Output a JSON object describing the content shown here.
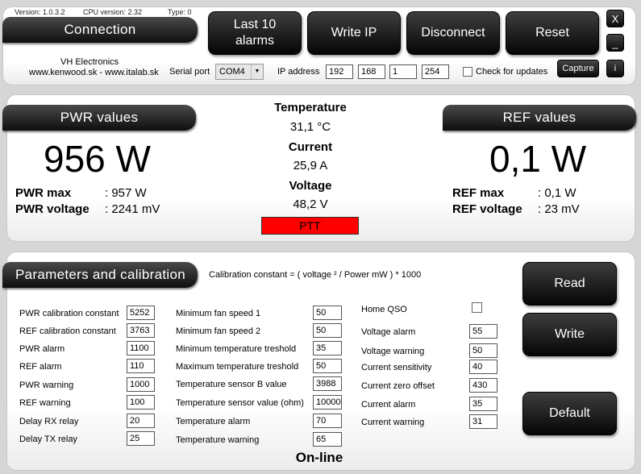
{
  "header": {
    "version": "Version: 1.0.3.2",
    "cpu_version": "CPU version: 2.32",
    "type": "Type: 0",
    "connection_tab": "Connection",
    "company": "VH  Electronics",
    "website": "www.kenwood.sk - www.italab.sk",
    "serial_port_label": "Serial port",
    "serial_port_value": "COM4",
    "ip_label": "IP address",
    "ip": [
      "192",
      "168",
      "1",
      "254"
    ],
    "check_updates": "Check for updates",
    "buttons": {
      "last_alarms": "Last 10\nalarms",
      "write_ip": "Write IP",
      "disconnect": "Disconnect",
      "reset": "Reset",
      "close": "X",
      "minimize": "_",
      "capture": "Capture",
      "info": "i"
    }
  },
  "measure": {
    "pwr_tab": "PWR values",
    "ref_tab": "REF values",
    "pwr_value": "956 W",
    "ref_value": "0,1 W",
    "pwr_max_label": "PWR max",
    "pwr_max_value": ": 957 W",
    "pwr_voltage_label": "PWR voltage",
    "pwr_voltage_value": ": 2241 mV",
    "ref_max_label": "REF max",
    "ref_max_value": ": 0,1 W",
    "ref_voltage_label": "REF voltage",
    "ref_voltage_value": ": 23 mV",
    "temperature_label": "Temperature",
    "temperature_value": "31,1 °C",
    "current_label": "Current",
    "current_value": "25,9 A",
    "voltage_label": "Voltage",
    "voltage_value": "48,2 V",
    "ptt": "PTT",
    "ptt_color": "#ff0000"
  },
  "params": {
    "tab": "Parameters and calibration",
    "formula": "Calibration constant = ( voltage ² / Power mW ) * 1000",
    "col1": [
      {
        "label": "PWR calibration constant",
        "value": "5252"
      },
      {
        "label": "REF calibration constant",
        "value": "3763"
      },
      {
        "label": "PWR alarm",
        "value": "1100"
      },
      {
        "label": "REF alarm",
        "value": "110"
      },
      {
        "label": "PWR warning",
        "value": "1000"
      },
      {
        "label": "REF warning",
        "value": "100"
      },
      {
        "label": "Delay RX relay",
        "value": "20"
      },
      {
        "label": "Delay TX relay",
        "value": "25"
      }
    ],
    "col2": [
      {
        "label": "Minimum fan speed 1",
        "value": "50"
      },
      {
        "label": "Minimum fan speed 2",
        "value": "50"
      },
      {
        "label": "Minimum  temperature treshold",
        "value": "35"
      },
      {
        "label": "Maximum  temperature treshold",
        "value": "50"
      },
      {
        "label": "Temperature sensor B value",
        "value": "3988"
      },
      {
        "label": "Temperature  sensor value (ohm)",
        "value": "10000"
      },
      {
        "label": "Temperature alarm",
        "value": "70"
      },
      {
        "label": "Temperature warning",
        "value": "65"
      }
    ],
    "home_qso": "Home QSO",
    "col3": [
      {
        "label": "Voltage alarm",
        "value": "55"
      },
      {
        "label": "Voltage warning",
        "value": "50"
      },
      {
        "label": "Current sensitivity",
        "value": "40"
      },
      {
        "label": "Current zero offset",
        "value": "430"
      },
      {
        "label": "Current alarm",
        "value": "35"
      },
      {
        "label": "Current warning",
        "value": "31"
      }
    ],
    "read_button": "Read",
    "write_button": "Write",
    "default_button": "Default"
  },
  "status": "On-line"
}
